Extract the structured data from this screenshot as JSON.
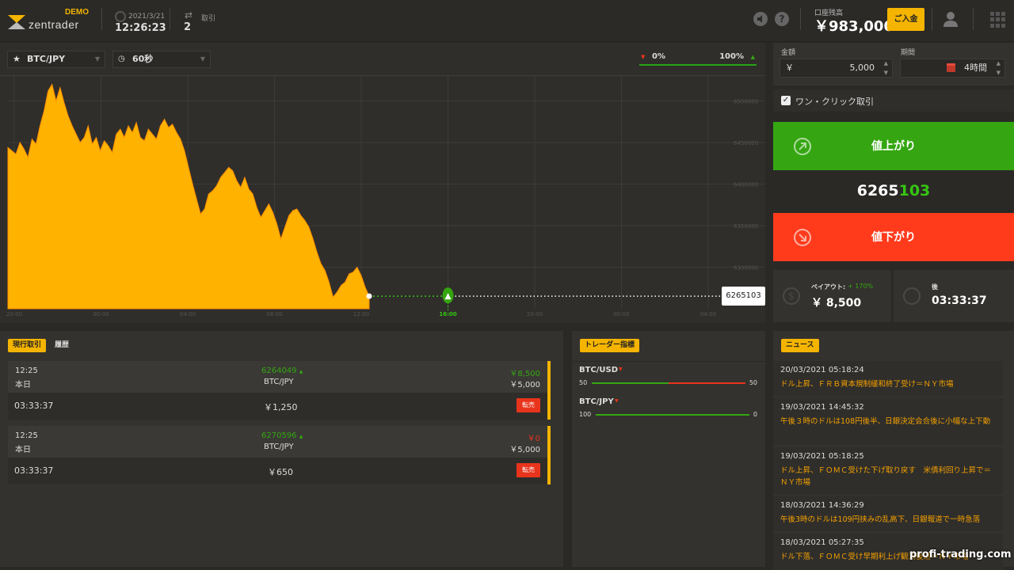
{
  "header": {
    "logo_text": "zentrader",
    "demo_badge": "DEMO",
    "date": "2021/3/21",
    "time": "12:26:23",
    "trades_label": "取引",
    "trades_count": "2",
    "balance_label": "口座残高",
    "balance_value": "￥983,000",
    "deposit_label": "ご入金",
    "icons": [
      "volume-icon",
      "help-icon",
      "user-icon",
      "apps-grid-icon"
    ]
  },
  "chart_toolbar": {
    "asset": "BTC/JPY",
    "timeframe": "60秒",
    "pct_left": "0%",
    "pct_right": "100%"
  },
  "chart_data": {
    "type": "area",
    "series": [
      {
        "values": [
          6444000,
          6440000,
          6436000,
          6450000,
          6442000,
          6432000,
          6454000,
          6448000,
          6470000,
          6488000,
          6512000,
          6520000,
          6500000,
          6516000,
          6498000,
          6482000,
          6470000,
          6460000,
          6450000,
          6456000,
          6470000,
          6448000,
          6456000,
          6440000,
          6452000,
          6446000,
          6438000,
          6460000,
          6466000,
          6456000,
          6470000,
          6462000,
          6474000,
          6456000,
          6452000,
          6466000,
          6460000,
          6454000,
          6470000,
          6478000,
          6468000,
          6472000,
          6462000,
          6454000,
          6440000,
          6420000,
          6400000,
          6382000,
          6364000,
          6370000,
          6388000,
          6392000,
          6398000,
          6408000,
          6414000,
          6420000,
          6416000,
          6404000,
          6396000,
          6408000,
          6394000,
          6388000,
          6372000,
          6360000,
          6368000,
          6376000,
          6366000,
          6352000,
          6334000,
          6348000,
          6362000,
          6368000,
          6370000,
          6362000,
          6356000,
          6348000,
          6334000,
          6318000,
          6304000,
          6296000,
          6282000,
          6264000,
          6270000,
          6278000,
          6282000,
          6292000,
          6294000,
          6300000,
          6290000,
          6276000,
          6265103
        ]
      }
    ],
    "x_tick_labels": [
      "20:00",
      "00:00",
      "04:00",
      "08:00",
      "12:00",
      "16:00",
      "20:00",
      "00:00",
      "04:00"
    ],
    "active_x_tick": "16:00",
    "y_tick_labels": [
      "6500000",
      "6450000",
      "6400000",
      "6350000",
      "6300000"
    ],
    "ylim": [
      6250000,
      6530000
    ],
    "current_price_label": "6265103",
    "fill_color": "#ffb300",
    "grid": true
  },
  "order": {
    "amount_label": "金額",
    "currency": "￥",
    "amount_value": "5,000",
    "period_label": "期間",
    "period_value": "4時間",
    "one_click_label": "ワン・クリック取引",
    "one_click_checked": true,
    "up_label": "値上がり",
    "down_label": "値下がり",
    "price_main": "6265",
    "price_highlight": "103",
    "payout_label": "ペイアウト:",
    "payout_pct": "+ 170%",
    "payout_value": "￥ 8,500",
    "time_label": "後",
    "time_value": "03:33:37",
    "up_color": "#35a612",
    "down_color": "#ff3b1c"
  },
  "trades": {
    "tab_active": "現行取引",
    "tab_history": "履歴",
    "items": [
      {
        "time": "12:25",
        "day": "本日",
        "entry": "6264049",
        "asset": "BTC/JPY",
        "payout": "￥8,500",
        "amount": "￥5,000",
        "remaining": "03:33:37",
        "value": "￥1,250",
        "sell": "転売"
      },
      {
        "time": "12:25",
        "day": "本日",
        "entry": "6270596",
        "asset": "BTC/JPY",
        "payout": "￥0",
        "amount": "￥5,000",
        "remaining": "03:33:37",
        "value": "￥650",
        "sell": "転売"
      }
    ]
  },
  "indicators": {
    "tab": "トレーダー指標",
    "items": [
      {
        "pair": "BTC/USD",
        "left": "50",
        "right": "50",
        "up_share": 0.5
      },
      {
        "pair": "BTC/JPY",
        "left": "100",
        "right": "0",
        "up_share": 1.0
      }
    ]
  },
  "news": {
    "tab": "ニュース",
    "items": [
      {
        "date": "20/03/2021 05:18:24",
        "text": "ドル上昇、ＦＲＢ資本規制緩和終了受け＝ＮＹ市場"
      },
      {
        "date": "19/03/2021 14:45:32",
        "text": "午後３時のドルは108円後半、日銀決定会合後に小幅な上下動"
      },
      {
        "date": "19/03/2021 05:18:25",
        "text": "ドル上昇、ＦＯＭＣ受けた下げ取り戻す　米債利回り上昇で＝ＮＹ市場"
      },
      {
        "date": "18/03/2021 14:36:29",
        "text": "午後3時のドルは109円挟みの乱高下、日銀報道で一時急落"
      },
      {
        "date": "18/03/2021 05:27:35",
        "text": "ドル下落、ＦＯＭＣ受け早期利上げ観測後退＝ＮＹ市場"
      }
    ]
  },
  "watermark": "profi-trading.com"
}
